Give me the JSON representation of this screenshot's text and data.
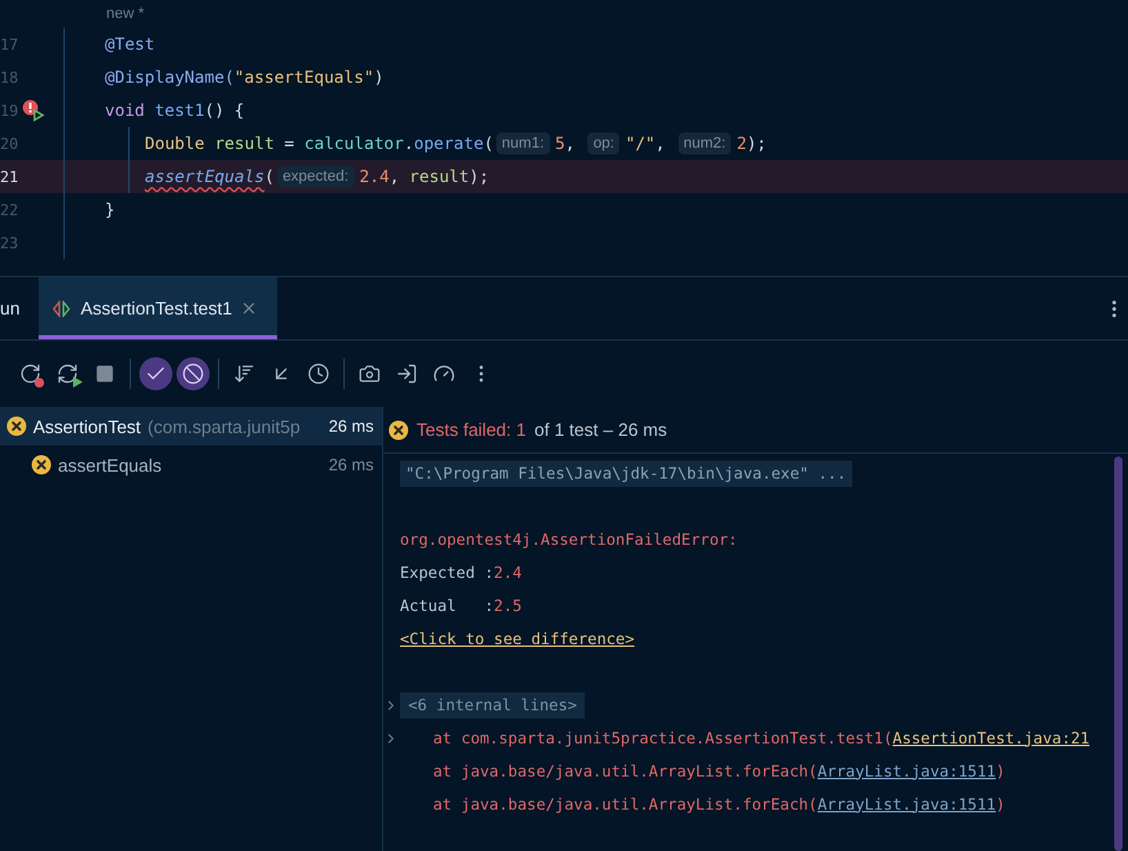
{
  "editor": {
    "top_hint": "new *",
    "lines": [
      {
        "number": "17",
        "current": false,
        "tokens": [
          {
            "kind": "annotation",
            "text": "@Test"
          }
        ]
      },
      {
        "number": "18",
        "current": false,
        "tokens": [
          {
            "kind": "annotation",
            "text": "@DisplayName("
          },
          {
            "kind": "string",
            "text": "\"assertEquals\""
          },
          {
            "kind": "plain",
            "text": ")"
          }
        ]
      },
      {
        "number": "19",
        "current": false,
        "failed_run_marker": true,
        "tokens": [
          {
            "kind": "keyword",
            "text": "void "
          },
          {
            "kind": "method",
            "text": "test1"
          },
          {
            "kind": "plain",
            "text": "() {"
          }
        ]
      },
      {
        "number": "20",
        "current": false,
        "indent": true,
        "tokens": [
          {
            "kind": "type",
            "text": "Double "
          },
          {
            "kind": "variable",
            "text": "result"
          },
          {
            "kind": "plain",
            "text": " = "
          },
          {
            "kind": "field",
            "text": "calculator"
          },
          {
            "kind": "plain",
            "text": "."
          },
          {
            "kind": "method",
            "text": "operate"
          },
          {
            "kind": "plain",
            "text": "("
          },
          {
            "kind": "hint",
            "text": "num1:"
          },
          {
            "kind": "number",
            "text": "5"
          },
          {
            "kind": "plain",
            "text": ", "
          },
          {
            "kind": "hint",
            "text": "op:"
          },
          {
            "kind": "string",
            "text": "\"/\""
          },
          {
            "kind": "plain",
            "text": ", "
          },
          {
            "kind": "hint",
            "text": "num2:"
          },
          {
            "kind": "number",
            "text": "2"
          },
          {
            "kind": "plain",
            "text": ");"
          }
        ]
      },
      {
        "number": "21",
        "current": true,
        "indent": true,
        "tokens": [
          {
            "kind": "static_error",
            "text": "assertEquals"
          },
          {
            "kind": "plain",
            "text": "("
          },
          {
            "kind": "hint",
            "text": "expected:"
          },
          {
            "kind": "number",
            "text": "2.4"
          },
          {
            "kind": "plain",
            "text": ", "
          },
          {
            "kind": "variable",
            "text": "result"
          },
          {
            "kind": "plain",
            "text": ");"
          }
        ]
      },
      {
        "number": "22",
        "current": false,
        "tokens": [
          {
            "kind": "plain",
            "text": "}"
          }
        ]
      },
      {
        "number": "23",
        "current": false
      }
    ]
  },
  "tool_window": {
    "tabs": [
      {
        "label": "un",
        "selected": false,
        "closable": false
      },
      {
        "label": "AssertionTest.test1",
        "selected": true,
        "closable": true
      }
    ]
  },
  "toolbar": {
    "groups": [
      [
        {
          "kind": "rerun-failed",
          "on": false
        },
        {
          "kind": "rerun",
          "on": false
        },
        {
          "kind": "stop",
          "on": false
        }
      ],
      [
        {
          "kind": "show-passed",
          "on": true
        },
        {
          "kind": "show-ignored",
          "on": true
        }
      ],
      [
        {
          "kind": "sort",
          "on": false
        },
        {
          "kind": "collapse",
          "on": false
        },
        {
          "kind": "history",
          "on": false
        }
      ],
      [
        {
          "kind": "camera",
          "on": false
        },
        {
          "kind": "import",
          "on": false
        },
        {
          "kind": "gauge",
          "on": false
        },
        {
          "kind": "more",
          "on": false
        }
      ]
    ]
  },
  "test_tree": [
    {
      "name": "AssertionTest",
      "detail": "(com.sparta.junit5p",
      "time": "26 ms",
      "failed": true,
      "selected": true,
      "children": [
        {
          "name": "assertEquals",
          "time": "26 ms",
          "failed": true,
          "selected": false
        }
      ]
    }
  ],
  "summary": {
    "failed": true,
    "label": "Tests failed:",
    "count": "1",
    "rest": "of 1 test – 26 ms"
  },
  "console": [
    {
      "kind": "command",
      "text": "\"C:\\Program Files\\Java\\jdk-17\\bin\\java.exe\" ..."
    },
    {
      "kind": "blank"
    },
    {
      "kind": "error",
      "text": "org.opentest4j.AssertionFailedError:"
    },
    {
      "kind": "value",
      "label": "Expected :",
      "value": "2.4"
    },
    {
      "kind": "value",
      "label": "Actual   :",
      "value": "2.5"
    },
    {
      "kind": "diff_link",
      "text": "<Click to see difference>"
    },
    {
      "kind": "blank"
    },
    {
      "kind": "folded",
      "text": "<6 internal lines>"
    },
    {
      "kind": "stack",
      "expandable": true,
      "prefix": "at com.sparta.junit5practice.AssertionTest.test1(",
      "link": "AssertionTest.java:21"
    },
    {
      "kind": "stack",
      "expandable": false,
      "prefix": "at java.base/java.util.ArrayList.forEach(",
      "link": "ArrayList.java:1511",
      "suffix": ")"
    },
    {
      "kind": "stack",
      "expandable": false,
      "prefix": "at java.base/java.util.ArrayList.forEach(",
      "link": "ArrayList.java:1511",
      "suffix": ")"
    }
  ]
}
